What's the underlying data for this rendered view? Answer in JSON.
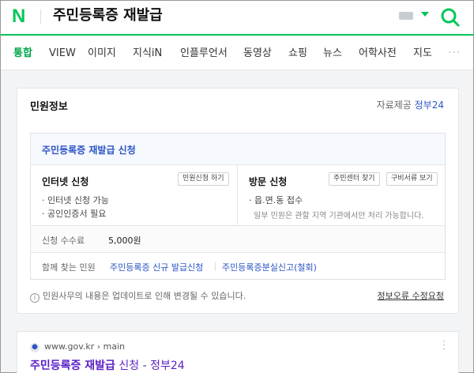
{
  "header": {
    "logo": "N",
    "query": "주민등록증 재발급"
  },
  "tabs": [
    "통합",
    "VIEW",
    "이미지",
    "지식iN",
    "인플루언서",
    "동영상",
    "쇼핑",
    "뉴스",
    "어학사전",
    "지도"
  ],
  "tab_more": "···",
  "card": {
    "title": "민원정보",
    "provider_prefix": "자료제공",
    "provider_link": "정부24",
    "inner_title": "주민등록증 재발급 신청",
    "internet": {
      "head": "인터넷 신청",
      "button": "민원신청 하기",
      "lines": [
        "· 인터넷 신청 가능",
        "· 공인인증서 필요"
      ]
    },
    "visit": {
      "head": "방문 신청",
      "buttons": [
        "주민센터 찾기",
        "구비서류 보기"
      ],
      "line": "· 읍.면.동 접수",
      "note": "일부 민원은 관할 지역 기관에서만 처리 가능합니다."
    },
    "fee_label": "신청 수수료",
    "fee_value": "5,000원",
    "related_label": "함께 찾는 민원",
    "related_links": [
      "주민등록증 신규 발급신청",
      "주민등록증분실신고(철회)"
    ],
    "footer_note": "민원사무의 내용은 업데이트로 인해 변경될 수 있습니다.",
    "report_link": "정보오류 수정요청"
  },
  "result": {
    "url": "www.gov.kr › main",
    "title_bold": "주민등록증 재발급",
    "title_rest": " 신청 - 정부24"
  },
  "colors": {
    "brand": "#03c75a",
    "link": "#2c54c6",
    "visited": "#5a1fc6"
  }
}
